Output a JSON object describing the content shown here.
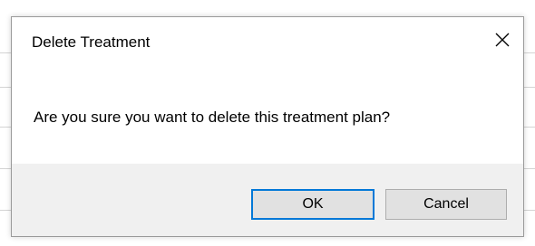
{
  "dialog": {
    "title": "Delete Treatment",
    "message": "Are you sure you want to delete this treatment plan?",
    "close_icon": "close-icon",
    "buttons": {
      "ok_label": "OK",
      "cancel_label": "Cancel"
    },
    "colors": {
      "focus_border": "#0078d7",
      "footer_bg": "#f0f0f0",
      "button_bg": "#e1e1e1"
    }
  }
}
